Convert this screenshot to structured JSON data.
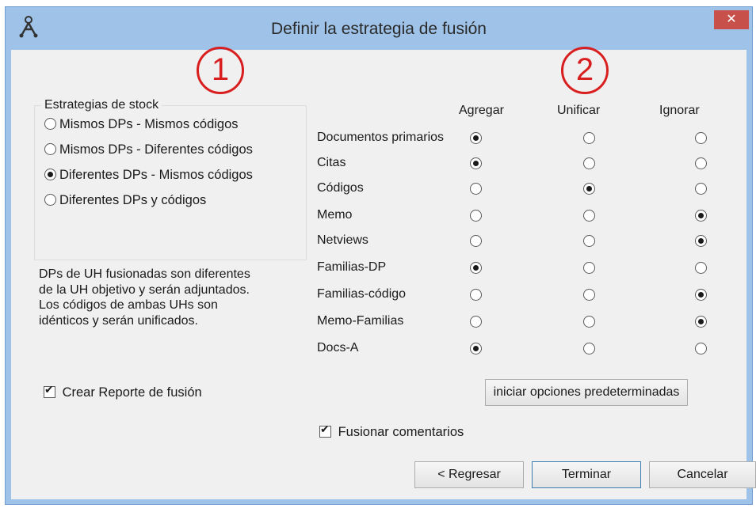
{
  "window": {
    "title": "Definir la estrategia de fusión",
    "close_glyph": "✕",
    "app_icon": "person-network-icon"
  },
  "markers": [
    "1",
    "2"
  ],
  "stock": {
    "legend": "Estrategias de stock",
    "options": [
      {
        "label": "Mismos DPs - Mismos códigos",
        "selected": false
      },
      {
        "label": "Mismos DPs - Diferentes códigos",
        "selected": false
      },
      {
        "label": "Diferentes DPs - Mismos códigos",
        "selected": true
      },
      {
        "label": "Diferentes DPs y códigos",
        "selected": false
      }
    ]
  },
  "description": [
    "DPs de UH fusionadas son diferentes",
    "de la UH objetivo y serán adjuntados.",
    "Los códigos de ambas UHs son",
    "idénticos y serán unificados."
  ],
  "crear_reporte": {
    "label": "Crear Reporte de fusión",
    "checked": true
  },
  "matrix": {
    "columns": [
      "Agregar",
      "Unificar",
      "Ignorar"
    ],
    "rows": [
      {
        "label": "Documentos primarios",
        "choice": 0
      },
      {
        "label": "Citas",
        "choice": 0
      },
      {
        "label": "Códigos",
        "choice": 1
      },
      {
        "label": "Memo",
        "choice": 2
      },
      {
        "label": "Netviews",
        "choice": 2
      },
      {
        "label": "Familias-DP",
        "choice": 0
      },
      {
        "label": "Familias-código",
        "choice": 2
      },
      {
        "label": "Memo-Familias",
        "choice": 2
      },
      {
        "label": "Docs-A",
        "choice": 0
      }
    ]
  },
  "reset_button": "iniciar opciones predeterminadas",
  "fusionar_comentarios": {
    "label": "Fusionar comentarios",
    "checked": true
  },
  "buttons": {
    "back": "< Regresar",
    "finish": "Terminar",
    "cancel": "Cancelar"
  }
}
